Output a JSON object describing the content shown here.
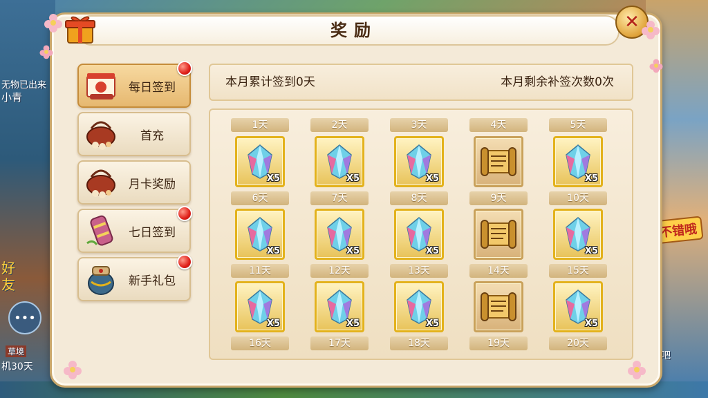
{
  "window": {
    "title": "奖励"
  },
  "menu": [
    {
      "label": "每日签到",
      "icon": "calendar-scroll-icon",
      "active": true,
      "has_dot": true
    },
    {
      "label": "首充",
      "icon": "basket-icon",
      "active": false,
      "has_dot": false
    },
    {
      "label": "月卡奖励",
      "icon": "basket-icon",
      "active": false,
      "has_dot": false
    },
    {
      "label": "七日签到",
      "icon": "scroll-roll-icon",
      "active": false,
      "has_dot": true
    },
    {
      "label": "新手礼包",
      "icon": "treasure-pot-icon",
      "active": false,
      "has_dot": true
    }
  ],
  "info": {
    "monthly_signed": "本月累计签到0天",
    "remaining_makeup": "本月剩余补签次数0次"
  },
  "days": [
    {
      "label": "1天",
      "item": "crystal-icon",
      "qty": "X5"
    },
    {
      "label": "2天",
      "item": "crystal-icon",
      "qty": "X5"
    },
    {
      "label": "3天",
      "item": "crystal-icon",
      "qty": "X5"
    },
    {
      "label": "4天",
      "item": "scroll-icon",
      "qty": ""
    },
    {
      "label": "5天",
      "item": "crystal-icon",
      "qty": "X5"
    },
    {
      "label": "6天",
      "item": "crystal-icon",
      "qty": "X5"
    },
    {
      "label": "7天",
      "item": "crystal-icon",
      "qty": "X5"
    },
    {
      "label": "8天",
      "item": "crystal-icon",
      "qty": "X5"
    },
    {
      "label": "9天",
      "item": "scroll-icon",
      "qty": ""
    },
    {
      "label": "10天",
      "item": "crystal-icon",
      "qty": "X5"
    },
    {
      "label": "11天",
      "item": "crystal-icon",
      "qty": "X5"
    },
    {
      "label": "12天",
      "item": "crystal-icon",
      "qty": "X5"
    },
    {
      "label": "13天",
      "item": "crystal-icon",
      "qty": "X5"
    },
    {
      "label": "14天",
      "item": "scroll-icon",
      "qty": ""
    },
    {
      "label": "15天",
      "item": "crystal-icon",
      "qty": "X5"
    },
    {
      "label": "16天"
    },
    {
      "label": "17天"
    },
    {
      "label": "18天"
    },
    {
      "label": "19天"
    },
    {
      "label": "20天"
    }
  ],
  "background": {
    "chat_icon": "chat-bubble-icon",
    "sign_text": "不错哦",
    "left_text_1": "无物已出来",
    "left_text_2": "小青",
    "left_text_3": "好",
    "left_text_4": "友",
    "left_text_5": "草境",
    "left_text_6": "机30天",
    "right_text_1": "吧"
  },
  "colors": {
    "panel_bg": "#f4ead8",
    "slot_gold": "#e3b21c",
    "red_dot": "#e0201a",
    "text_dark": "#3b2412"
  }
}
